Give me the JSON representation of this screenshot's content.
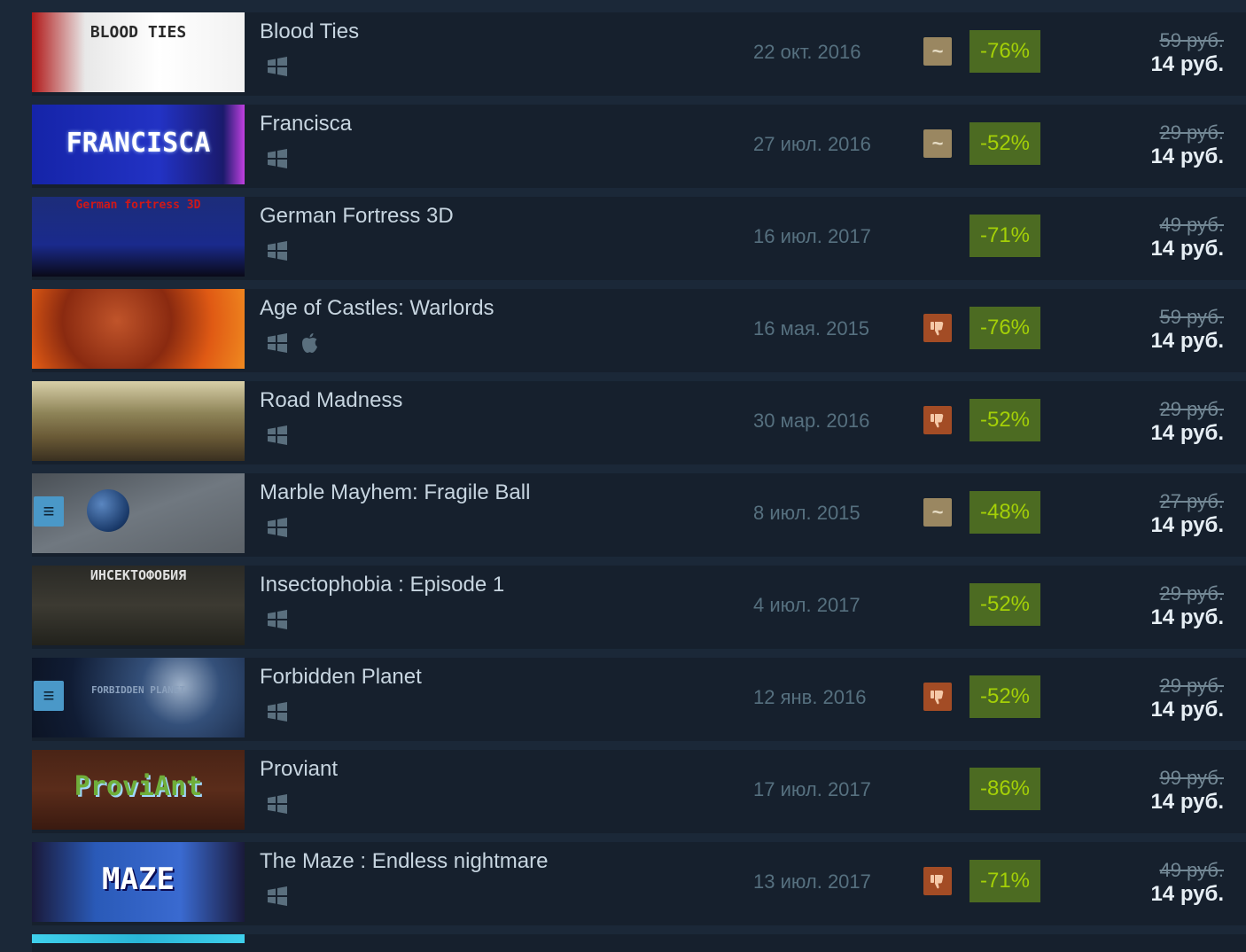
{
  "games": [
    {
      "title": "Blood Ties",
      "date": "22 окт. 2016",
      "review": "mixed",
      "review_icon": "tilde-icon",
      "discount": "-76%",
      "original_price": "59 руб.",
      "final_price": "14 руб.",
      "platforms": [
        "windows-icon"
      ],
      "thumb_caption": "BLOOD TIES",
      "wishlisted": false
    },
    {
      "title": "Francisca",
      "date": "27 июл. 2016",
      "review": "mixed",
      "review_icon": "tilde-icon",
      "discount": "-52%",
      "original_price": "29 руб.",
      "final_price": "14 руб.",
      "platforms": [
        "windows-icon"
      ],
      "thumb_caption": "FRANCISCA",
      "wishlisted": false
    },
    {
      "title": "German Fortress 3D",
      "date": "16 июл. 2017",
      "review": "none",
      "review_icon": "",
      "discount": "-71%",
      "original_price": "49 руб.",
      "final_price": "14 руб.",
      "platforms": [
        "windows-icon"
      ],
      "thumb_caption": "German fortress 3D",
      "wishlisted": false
    },
    {
      "title": "Age of Castles: Warlords",
      "date": "16 мая. 2015",
      "review": "negative",
      "review_icon": "thumbs-down-icon",
      "discount": "-76%",
      "original_price": "59 руб.",
      "final_price": "14 руб.",
      "platforms": [
        "windows-icon",
        "apple-icon"
      ],
      "thumb_caption": "",
      "wishlisted": false
    },
    {
      "title": "Road Madness",
      "date": "30 мар. 2016",
      "review": "negative",
      "review_icon": "thumbs-down-icon",
      "discount": "-52%",
      "original_price": "29 руб.",
      "final_price": "14 руб.",
      "platforms": [
        "windows-icon"
      ],
      "thumb_caption": "",
      "wishlisted": false
    },
    {
      "title": "Marble Mayhem: Fragile Ball",
      "date": "8 июл. 2015",
      "review": "mixed",
      "review_icon": "tilde-icon",
      "discount": "-48%",
      "original_price": "27 руб.",
      "final_price": "14 руб.",
      "platforms": [
        "windows-icon"
      ],
      "thumb_caption": "",
      "wishlisted": true
    },
    {
      "title": "Insectophobia : Episode 1",
      "date": "4 июл. 2017",
      "review": "none",
      "review_icon": "",
      "discount": "-52%",
      "original_price": "29 руб.",
      "final_price": "14 руб.",
      "platforms": [
        "windows-icon"
      ],
      "thumb_caption": "ИНСЕКТОФОБИЯ",
      "wishlisted": false
    },
    {
      "title": "Forbidden Planet",
      "date": "12 янв. 2016",
      "review": "negative",
      "review_icon": "thumbs-down-icon",
      "discount": "-52%",
      "original_price": "29 руб.",
      "final_price": "14 руб.",
      "platforms": [
        "windows-icon"
      ],
      "thumb_caption": "FORBIDDEN PLANET",
      "wishlisted": true
    },
    {
      "title": "Proviant",
      "date": "17 июл. 2017",
      "review": "none",
      "review_icon": "",
      "discount": "-86%",
      "original_price": "99 руб.",
      "final_price": "14 руб.",
      "platforms": [
        "windows-icon"
      ],
      "thumb_caption": "ProviAnt",
      "wishlisted": false
    },
    {
      "title": "The Maze : Endless nightmare",
      "date": "13 июл. 2017",
      "review": "negative",
      "review_icon": "thumbs-down-icon",
      "discount": "-71%",
      "original_price": "49 руб.",
      "final_price": "14 руб.",
      "platforms": [
        "windows-icon"
      ],
      "thumb_caption": "MAZE",
      "wishlisted": false
    }
  ],
  "colors": {
    "background": "#1b2838",
    "row": "#16202d",
    "title": "#c7d5e0",
    "date": "#56707f",
    "discount_bg": "#4c6b22",
    "discount_text": "#a4d007",
    "mixed": "#9a8761",
    "negative": "#a34c25",
    "wishlist": "#4a98c8"
  }
}
